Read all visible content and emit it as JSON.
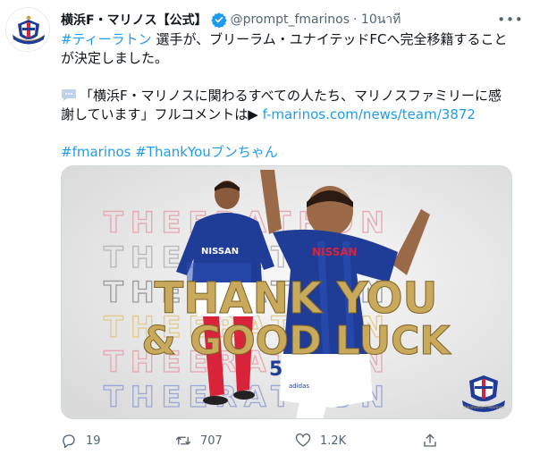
{
  "account": {
    "display_name": "横浜F・マリノス【公式】",
    "handle": "@prompt_fmarinos",
    "time": "· 10นาที",
    "verified": true
  },
  "tweet": {
    "hashtag_1": "#ティーラトン",
    "line_1_rest": " 選手が、ブリーラム・ユナイテッドFCへ完全移籍すること",
    "line_2": "が決定しました。",
    "quote_icon": "speech-bubble-emoji",
    "line_3": "「横浜F・マリノスに関わるすべての人たち、マリノスファミリーに感",
    "line_4_text": "謝しています」フルコメントは▶ ",
    "line_4_link": "f-marinos.com/news/team/3872",
    "hashtag_2": "#fmarinos",
    "hashtag_3": "#ThankYouブンちゃん"
  },
  "media": {
    "repeated_text": "THEERATHON",
    "headline_1": "THANK YOU",
    "headline_2": "& GOOD LUCK",
    "jersey_sponsor": "NISSAN",
    "jersey_number": "5",
    "brand_mark": "adidas",
    "crest_caption": "Yokohama F·Marinos"
  },
  "actions": {
    "reply_count": "19",
    "retweet_count": "707",
    "like_count": "1.2K"
  },
  "colors": {
    "link": "#1d9bf0",
    "secondary_text": "#536471",
    "gold": "#c9a95c",
    "marinos_blue": "#1f3c96",
    "marinos_red": "#d8233a"
  }
}
